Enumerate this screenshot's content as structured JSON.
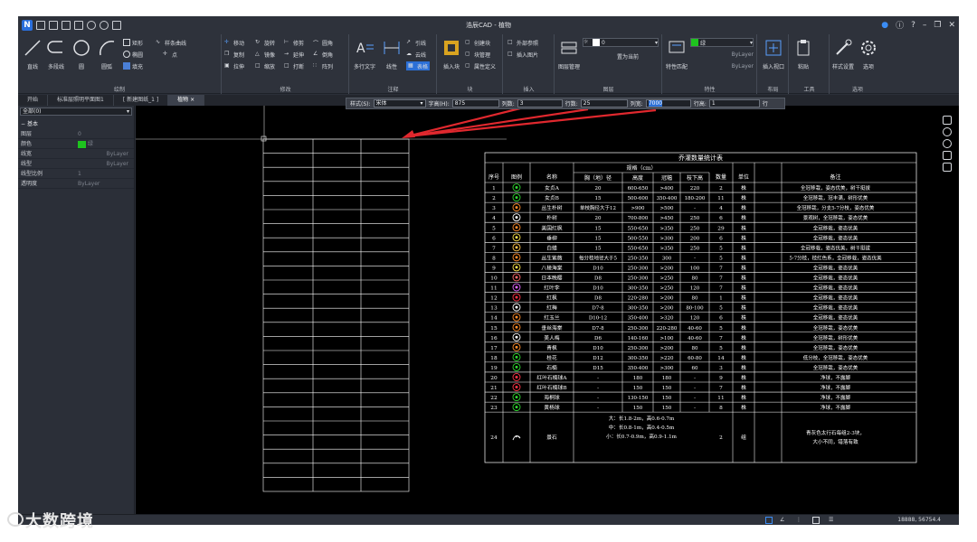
{
  "app": {
    "title": "浩辰CAD - 植物",
    "coords": "18888, 56754.4",
    "watermark": "大数跨境"
  },
  "ribbon": {
    "draw": {
      "label": "绘制",
      "line": "直线",
      "pline": "多段线",
      "circle": "圆",
      "arc": "圆弧",
      "rect": "矩形",
      "ellipse": "椭圆",
      "hatch": "填充",
      "spline": "样条曲线",
      "point": "点"
    },
    "modify": {
      "label": "修改",
      "move": "移动",
      "rotate": "旋转",
      "trim": "修剪",
      "fillet": "圆角",
      "copy": "复制",
      "mirror": "镜像",
      "extend": "延伸",
      "chamfer": "倒角",
      "stretch": "拉伸",
      "scale": "缩放",
      "break": "打断",
      "array": "阵列"
    },
    "annotate": {
      "label": "注释",
      "mtext": "多行文字",
      "dim": "线性",
      "leader": "引线",
      "cloud": "云线",
      "table": "表格"
    },
    "block": {
      "label": "块",
      "insert": "插入块",
      "create": "创建块",
      "manage": "块管理",
      "attdef": "属性定义"
    },
    "insert": {
      "label": "插入",
      "xref": "外部参照",
      "image": "插入图片"
    },
    "layer": {
      "label": "图层",
      "manager": "图层管理",
      "current_layer": "0",
      "set_current": "置为当前"
    },
    "props": {
      "label": "特性",
      "match": "特性匹配",
      "color": "绿",
      "linetype": "ByLayer",
      "lineweight": "ByLayer"
    },
    "layout": {
      "label": "布局",
      "viewport": "插入视口"
    },
    "tools": {
      "label": "工具",
      "paste": "粘贴"
    },
    "options": {
      "label": "选项",
      "style": "样式设置",
      "options": "选项"
    }
  },
  "tabs": [
    {
      "label": "开始"
    },
    {
      "label": "标准层照明平面图1"
    },
    {
      "label": "[ 新建图纸_1 ]"
    },
    {
      "label": "植物"
    }
  ],
  "properties": {
    "selection": "全部(0)",
    "section": "基本",
    "rows": [
      {
        "key": "图层",
        "value": "0"
      },
      {
        "key": "颜色",
        "value": "绿"
      },
      {
        "key": "线宽",
        "value": "ByLayer"
      },
      {
        "key": "线型",
        "value": "ByLayer"
      },
      {
        "key": "线型比例",
        "value": "1"
      },
      {
        "key": "透明度",
        "value": "ByLayer"
      }
    ],
    "accent_green": "#1ec41e"
  },
  "table_toolbar": {
    "style_label": "样式(S):",
    "style_value": "宋体",
    "height_label": "字高(H):",
    "height_value": "875",
    "cols_label": "列数:",
    "cols_value": "3",
    "rows_label": "行数:",
    "rows_value": "25",
    "colw_label": "列宽:",
    "colw_value": "7000",
    "rowh_label": "行高:",
    "rowh_value": "1",
    "unit": "行"
  },
  "plant_table": {
    "title": "乔灌数量统计表",
    "headers": {
      "no": "序号",
      "icon": "图例",
      "name": "名称",
      "spec": "规格（cm）",
      "dbh": "胸（地）径",
      "height": "高度",
      "crown": "冠幅",
      "branch": "枝下高",
      "qty": "数量",
      "unit": "单位",
      "note": "备注"
    },
    "rows": [
      [
        "1",
        "女贞A",
        "20",
        "600-650",
        ">400",
        "220",
        "2",
        "株",
        "全冠移栽，姿态优美，树干挺拔"
      ],
      [
        "2",
        "女贞B",
        "15",
        "500-600",
        "350-400",
        "180-200",
        "11",
        "株",
        "全冠移栽，冠丰满，树形优美"
      ],
      [
        "3",
        "丛生朴树",
        "单枝胸径大于12",
        ">900",
        ">500",
        "-",
        "4",
        "株",
        "全冠移栽，分支5-7分枝，姿态优美"
      ],
      [
        "4",
        "朴树",
        "20",
        "700-800",
        ">450",
        "250",
        "6",
        "株",
        "景观树，全冠移栽，姿态优美"
      ],
      [
        "5",
        "美国红枫",
        "15",
        "550-650",
        ">350",
        "250",
        "29",
        "株",
        "全冠移栽，姿态优美"
      ],
      [
        "6",
        "垂柳",
        "15",
        "500-550",
        ">300",
        "200",
        "6",
        "株",
        "全冠移栽，姿态优美"
      ],
      [
        "7",
        "白蜡",
        "15",
        "550-650",
        ">350",
        "250",
        "5",
        "株",
        "全冠移栽，姿态优美，树干挺拔"
      ],
      [
        "8",
        "丛生紫薇",
        "每分枝地径大于5",
        "250-350",
        "300",
        "-",
        "5",
        "株",
        "5-7分枝，枝红色系，全冠移栽，姿态优美"
      ],
      [
        "9",
        "八棱海棠",
        "D10",
        "250-300",
        ">200",
        "100",
        "7",
        "株",
        "全冠移栽，姿态优美"
      ],
      [
        "10",
        "日本晚樱",
        "D8",
        "250-300",
        ">250",
        "80",
        "7",
        "株",
        "全冠移栽，姿态优美"
      ],
      [
        "11",
        "红叶李",
        "D10",
        "300-350",
        ">250",
        "120",
        "7",
        "株",
        "全冠移栽，姿态优美"
      ],
      [
        "12",
        "红枫",
        "D8",
        "220-280",
        ">200",
        "80",
        "1",
        "株",
        "全冠移栽，姿态优美"
      ],
      [
        "13",
        "红梅",
        "D7-8",
        "300-350",
        ">200",
        "80-100",
        "5",
        "株",
        "全冠移栽，姿态优美"
      ],
      [
        "14",
        "红玉兰",
        "D10-12",
        "350-400",
        ">320",
        "120",
        "6",
        "株",
        "全冠移栽，姿态优美"
      ],
      [
        "15",
        "垂丝海棠",
        "D7-8",
        "250-300",
        "220-280",
        "40-60",
        "5",
        "株",
        "全冠移栽，姿态优美"
      ],
      [
        "16",
        "美人梅",
        "D6",
        "140-160",
        ">100",
        "40-60",
        "7",
        "株",
        "全冠移栽，树形优美"
      ],
      [
        "17",
        "青枫",
        "D10",
        "250-300",
        ">200",
        "80",
        "5",
        "株",
        "全冠移栽，姿态优美"
      ],
      [
        "18",
        "桂花",
        "D12",
        "300-350",
        ">220",
        "60-80",
        "14",
        "株",
        "低分枝，全冠移栽，姿态优美"
      ],
      [
        "19",
        "石楠",
        "D15",
        "350-400",
        ">300",
        "60",
        "3",
        "株",
        "全冠移栽，姿态优美"
      ],
      [
        "20",
        "红叶石楠球A",
        "-",
        "180",
        "180",
        "-",
        "9",
        "株",
        "净球，不露脚"
      ],
      [
        "21",
        "红叶石楠球B",
        "-",
        "150",
        "150",
        "-",
        "7",
        "株",
        "净球，不露脚"
      ],
      [
        "22",
        "海桐球",
        "-",
        "130-150",
        "150",
        "-",
        "11",
        "株",
        "净球，不露脚"
      ],
      [
        "23",
        "黄杨球",
        "-",
        "150",
        "150",
        "-",
        "8",
        "株",
        "净球，不露脚"
      ]
    ],
    "row24": {
      "no": "24",
      "name": "景石",
      "spec_lines": [
        "大：长1.8-2m，高0.6-0.7m",
        "中：长0.8-1m，高0.4-0.5m",
        "小：长0.7-0.9m，高0.9-1.1m"
      ],
      "qty": "2",
      "unit": "组",
      "note_lines": [
        "青灰色太行石每组2-3块，",
        "大小不同，错落有致"
      ]
    },
    "line_color": "#ffffff"
  },
  "arrow_color": "#e0282e"
}
